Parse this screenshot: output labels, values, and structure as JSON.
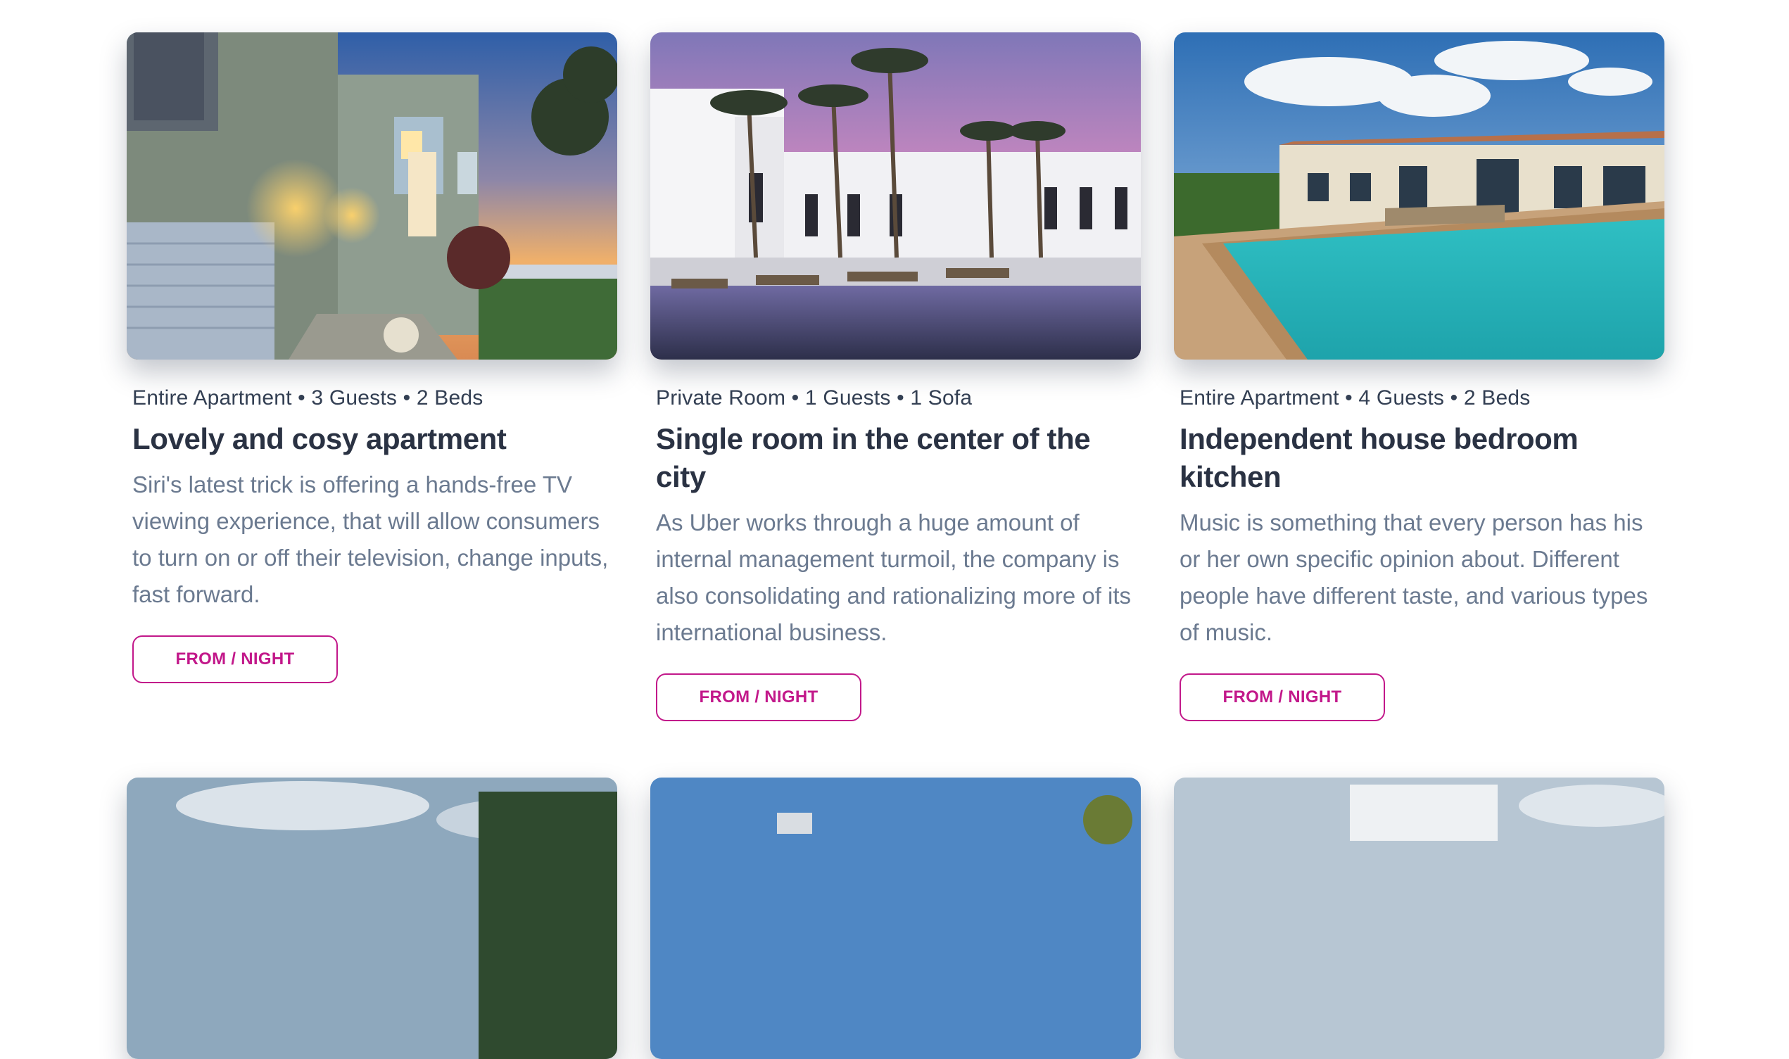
{
  "listings": [
    {
      "meta": "Entire Apartment • 3 Guests • 2 Beds",
      "title": "Lovely and cosy apartment",
      "description": "Siri's latest trick is offering a hands-free TV viewing experience, that will allow consumers to turn on or off their television, change inputs, fast forward.",
      "button_label": "FROM / NIGHT"
    },
    {
      "meta": "Private Room • 1 Guests • 1 Sofa",
      "title": "Single room in the center of the city",
      "description": "As Uber works through a huge amount of internal management turmoil, the company is also consolidating and rationalizing more of its international business.",
      "button_label": "FROM / NIGHT"
    },
    {
      "meta": "Entire Apartment • 4 Guests • 2 Beds",
      "title": "Independent house bedroom kitchen",
      "description": "Music is something that every person has his or her own specific opinion about. Different people have different taste, and various types of music.",
      "button_label": "FROM / NIGHT"
    }
  ],
  "theme": {
    "accent": "#c2188a",
    "text": "#344054",
    "title": "#2a3243",
    "muted": "#6b7a90"
  }
}
